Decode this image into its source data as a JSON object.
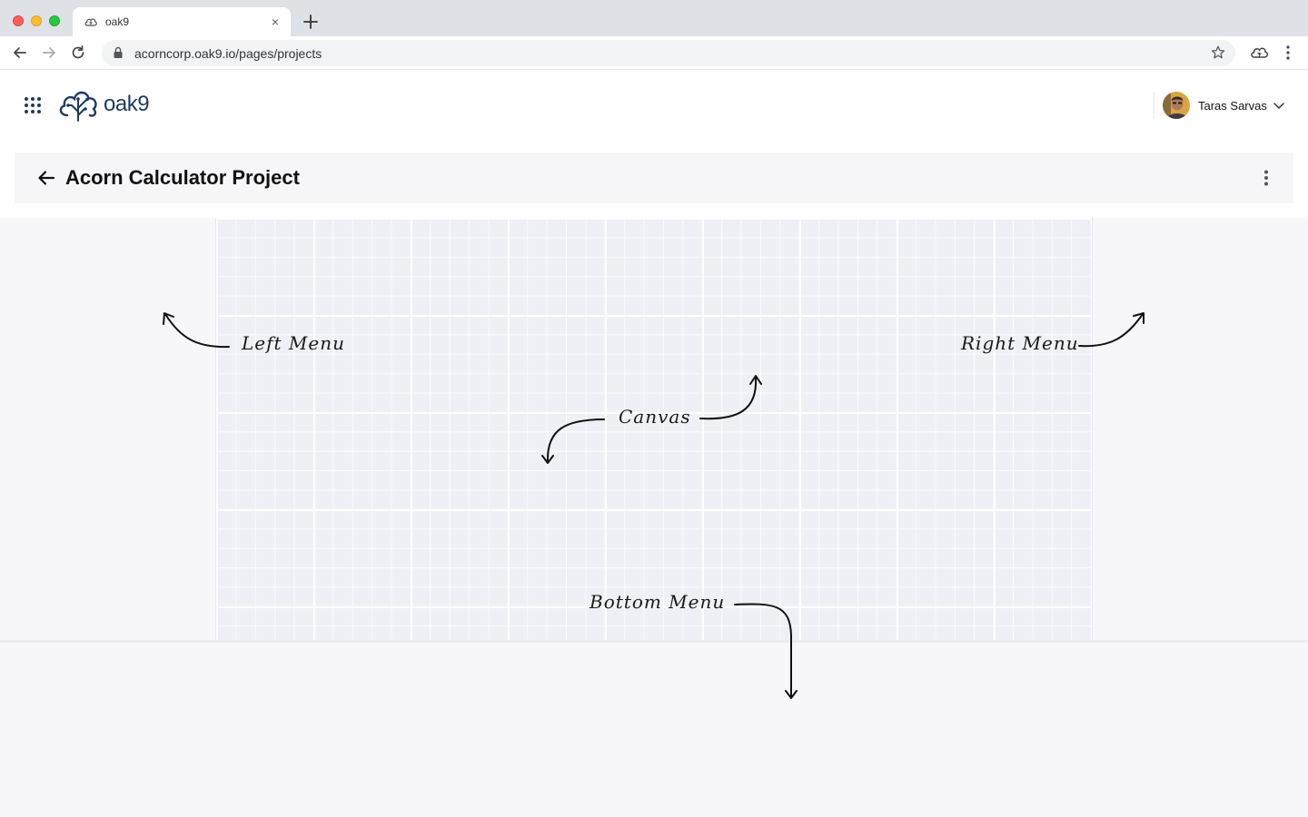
{
  "browser": {
    "tab": {
      "title": "oak9",
      "favicon": "oak9-cloud-icon",
      "close": "×"
    },
    "url": "acorncorp.oak9.io/pages/projects"
  },
  "app": {
    "brand": "oak9",
    "user": {
      "name": "Taras Sarvas"
    }
  },
  "project": {
    "title": "Acorn Calculator Project"
  },
  "annotations": {
    "left_menu": "Left Menu",
    "right_menu": "Right Menu",
    "canvas": "Canvas",
    "bottom_menu": "Bottom Menu"
  },
  "colors": {
    "brand": "#1d3a5f",
    "canvas_bg": "#eef0f5",
    "page_bg": "#f7f7f9",
    "tabstrip": "#dee1e6"
  }
}
